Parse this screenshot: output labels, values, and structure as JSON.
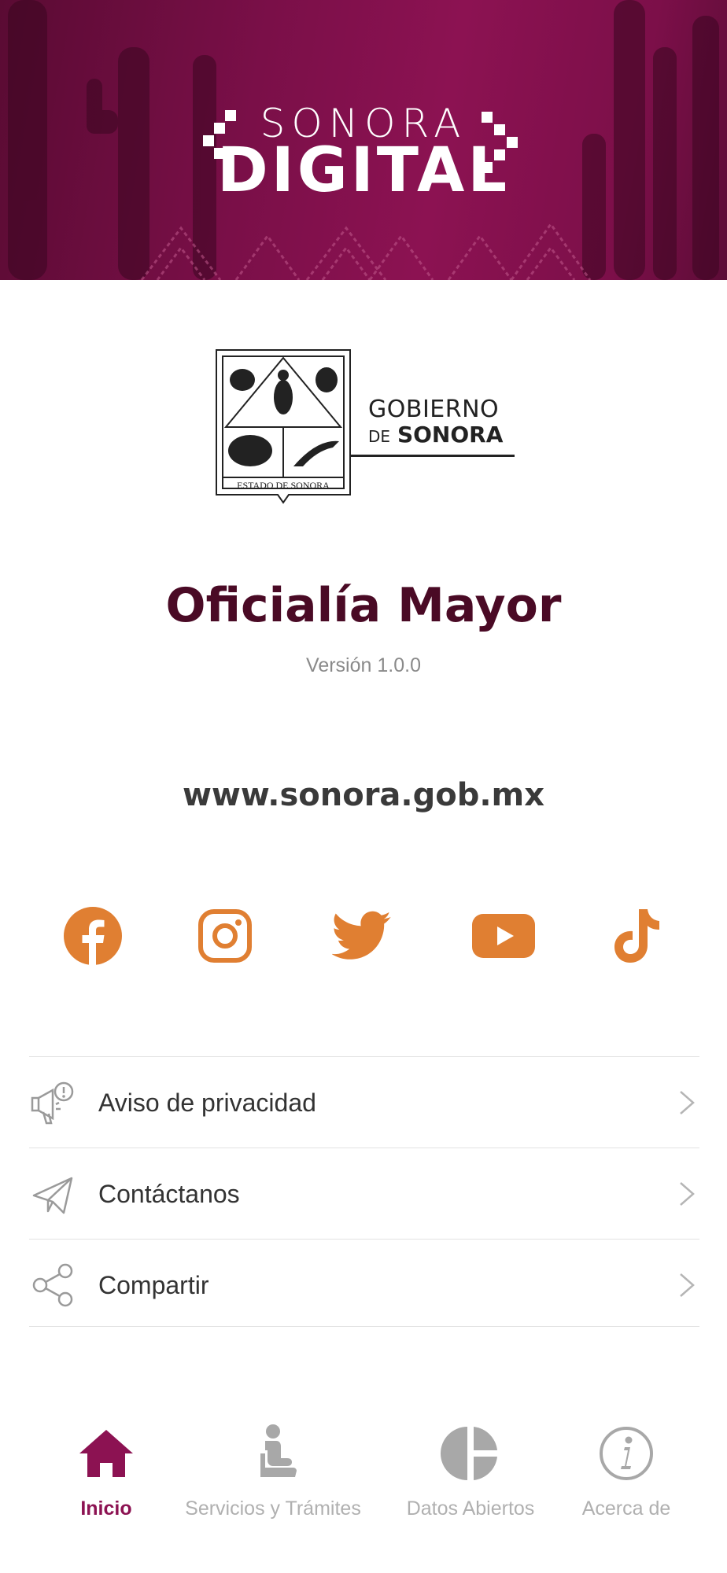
{
  "header": {
    "logo_top": "SONORA",
    "logo_bottom": "DIGITAL"
  },
  "government": {
    "seal_caption": "ESTADO DE SONORA",
    "line1": "GOBIERNO",
    "line2_prefix": "DE",
    "line2_main": "SONORA"
  },
  "app": {
    "title": "Oficialía Mayor",
    "version": "Versión 1.0.0",
    "website": "www.sonora.gob.mx"
  },
  "social": [
    {
      "name": "facebook-icon"
    },
    {
      "name": "instagram-icon"
    },
    {
      "name": "twitter-icon"
    },
    {
      "name": "youtube-icon"
    },
    {
      "name": "tiktok-icon"
    }
  ],
  "menu": [
    {
      "label": "Aviso de privacidad",
      "icon": "megaphone-icon"
    },
    {
      "label": "Contáctanos",
      "icon": "paper-plane-icon"
    },
    {
      "label": "Compartir",
      "icon": "share-icon"
    }
  ],
  "bottom_nav": [
    {
      "label": "Inicio",
      "icon": "home-icon",
      "active": true
    },
    {
      "label": "Servicios y Trámites",
      "icon": "service-person-icon",
      "active": false
    },
    {
      "label": "Datos Abiertos",
      "icon": "pie-chart-icon",
      "active": false
    },
    {
      "label": "Acerca de",
      "icon": "info-icon",
      "active": false
    }
  ],
  "colors": {
    "brand": "#8c1252",
    "title": "#4a0a25",
    "social": "#e07f32",
    "inactive": "#b0b0b0"
  }
}
